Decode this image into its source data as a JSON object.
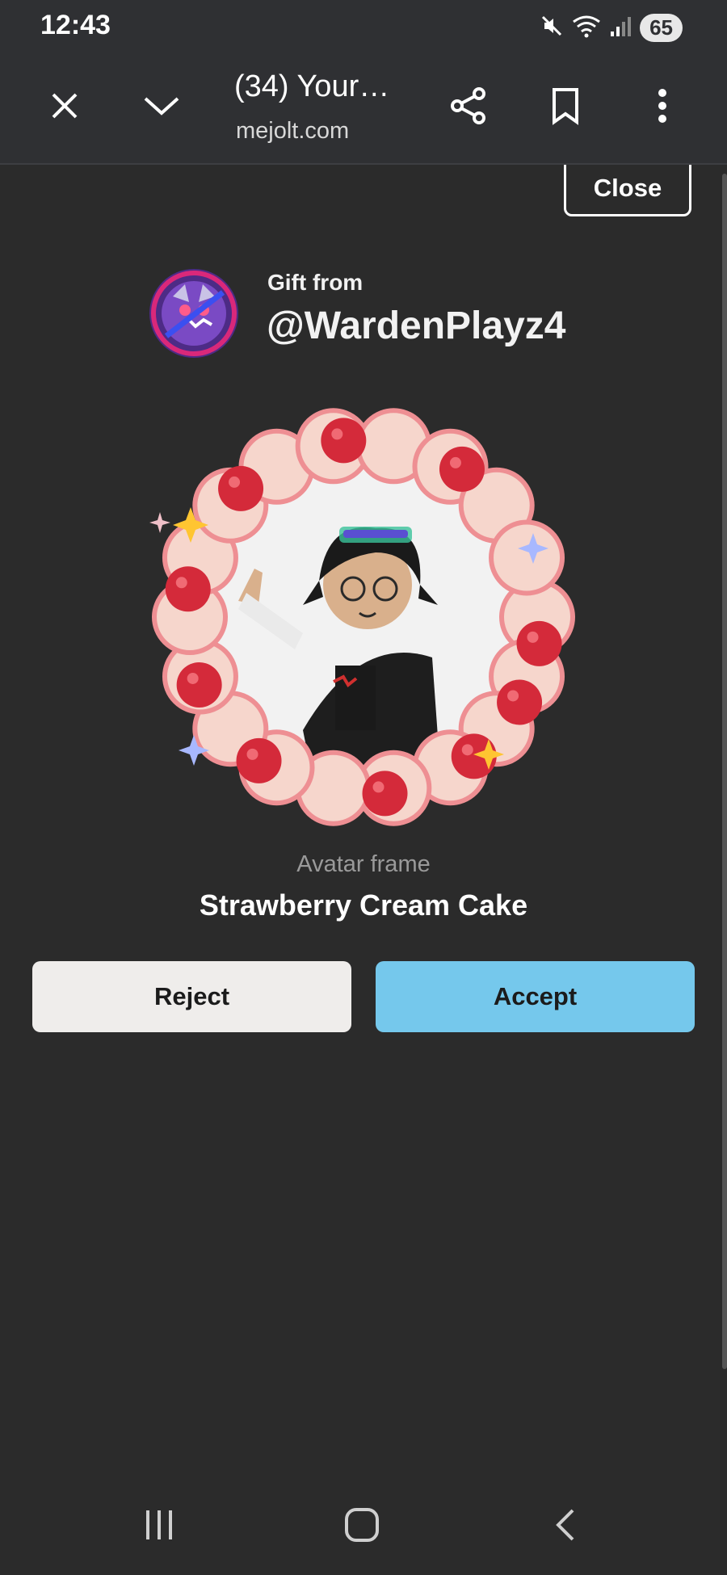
{
  "status_bar": {
    "time": "12:43",
    "battery": "65",
    "icons": [
      "mute-icon",
      "wifi-icon",
      "signal-icon",
      "battery-icon"
    ]
  },
  "browser": {
    "title": "(34) Your…",
    "url": "mejolt.com",
    "icons": [
      "close-icon",
      "chevron-down-icon",
      "share-icon",
      "bookmark-icon",
      "more-vertical-icon"
    ]
  },
  "gift": {
    "close_label": "Close",
    "from_label": "Gift from",
    "sender": "@WardenPlayz4",
    "item_type": "Avatar frame",
    "item_name": "Strawberry Cream Cake",
    "reject_label": "Reject",
    "accept_label": "Accept"
  },
  "nav": {
    "icons": [
      "recent-apps-icon",
      "home-icon",
      "back-icon"
    ]
  },
  "colors": {
    "background": "#2b2b2b",
    "bar": "#2f3033",
    "accept": "#75c8ec",
    "reject": "#efedeb",
    "frame_cream": "#f6d6cc",
    "frame_strawberry": "#d42a3a"
  }
}
